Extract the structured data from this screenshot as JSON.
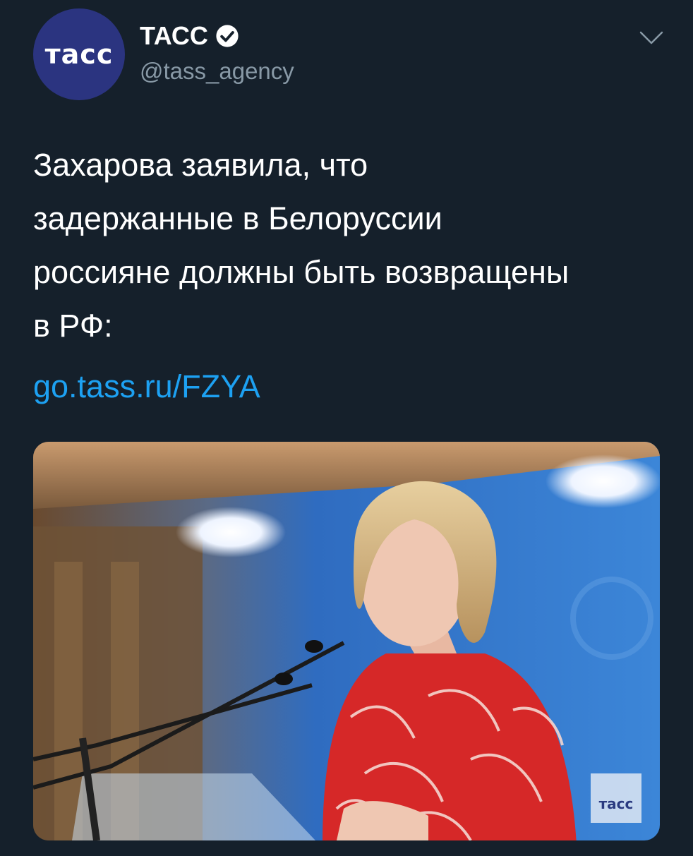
{
  "account": {
    "avatar_text": "тасс",
    "display_name": "ТАСС",
    "handle": "@tass_agency",
    "verified_icon": "verified-badge-icon",
    "menu_icon": "chevron-down-icon"
  },
  "tweet": {
    "text": "Захарова заявила, что\nзадержанные в Белоруссии\nроссияне должны быть возвращены\nв РФ:",
    "link": "go.tass.ru/FZYA"
  },
  "media": {
    "watermark": "тасс"
  },
  "colors": {
    "background": "#15202b",
    "link": "#1da1f2",
    "secondary_text": "#8899a6",
    "avatar_bg": "#2b3480"
  }
}
